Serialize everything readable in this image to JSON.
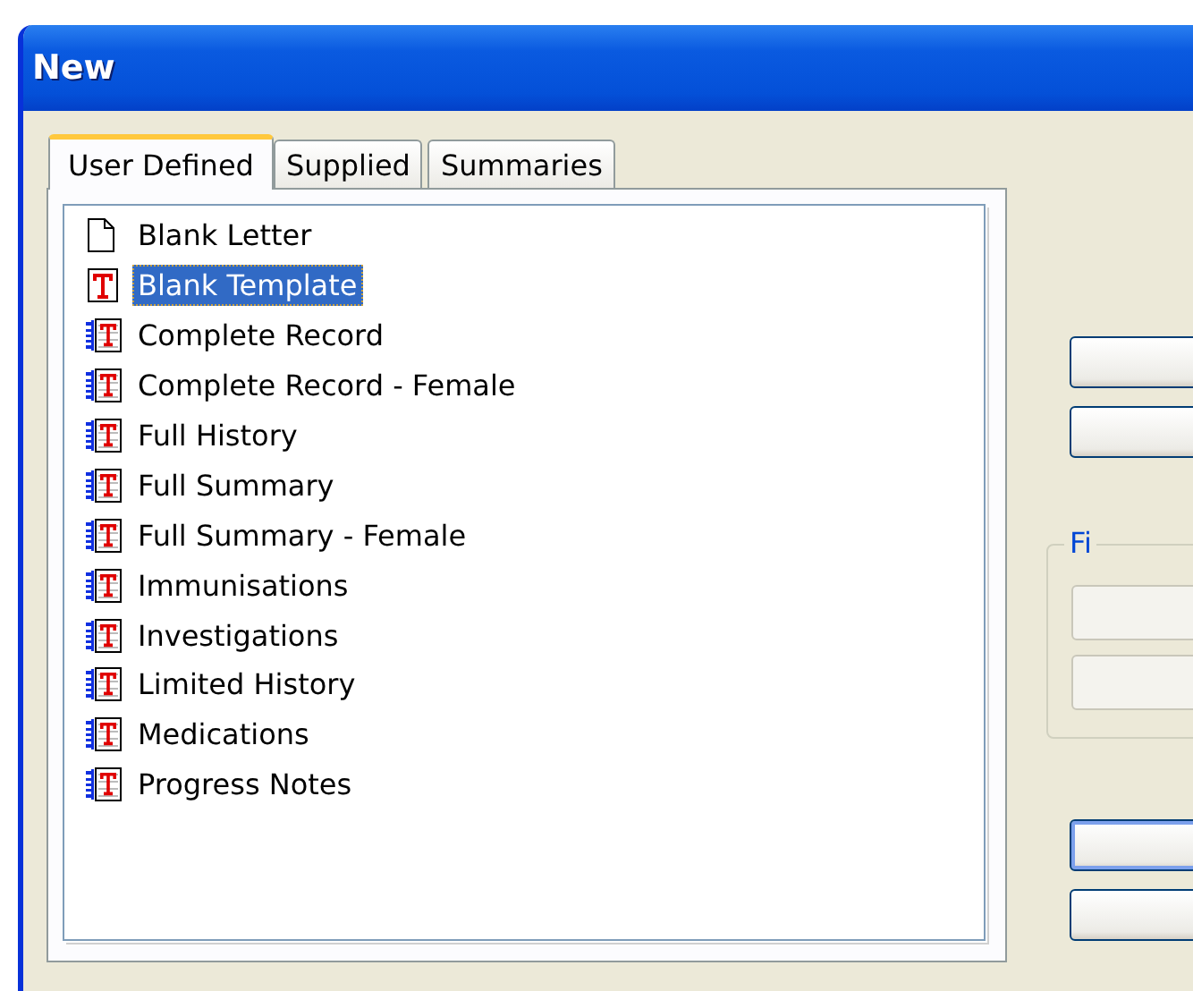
{
  "window": {
    "title": "New"
  },
  "tabs": [
    {
      "label": "User Defined",
      "selected": true
    },
    {
      "label": "Supplied",
      "selected": false
    },
    {
      "label": "Summaries",
      "selected": false
    }
  ],
  "items": [
    {
      "label": "Blank Letter",
      "kind": "blank",
      "selected": false
    },
    {
      "label": "Blank Template",
      "kind": "template",
      "selected": true
    },
    {
      "label": "Complete Record",
      "kind": "all",
      "selected": false
    },
    {
      "label": "Complete Record - Female",
      "kind": "all",
      "selected": false
    },
    {
      "label": "Full History",
      "kind": "all",
      "selected": false
    },
    {
      "label": "Full Summary",
      "kind": "all",
      "selected": false
    },
    {
      "label": "Full Summary - Female",
      "kind": "all",
      "selected": false
    },
    {
      "label": "Immunisations",
      "kind": "all",
      "selected": false
    },
    {
      "label": "Investigations",
      "kind": "all",
      "selected": false
    },
    {
      "label": "Limited History",
      "kind": "all",
      "selected": false
    },
    {
      "label": "Medications",
      "kind": "all",
      "selected": false
    },
    {
      "label": "Progress Notes",
      "kind": "all",
      "selected": false
    }
  ],
  "side_buttons": [
    {
      "disabled": false
    },
    {
      "disabled": false
    }
  ],
  "group": {
    "label": "Fi",
    "buttons": [
      {
        "disabled": true
      },
      {
        "disabled": true
      }
    ]
  },
  "bottom_buttons": [
    {
      "default": true
    },
    {
      "default": false
    }
  ]
}
